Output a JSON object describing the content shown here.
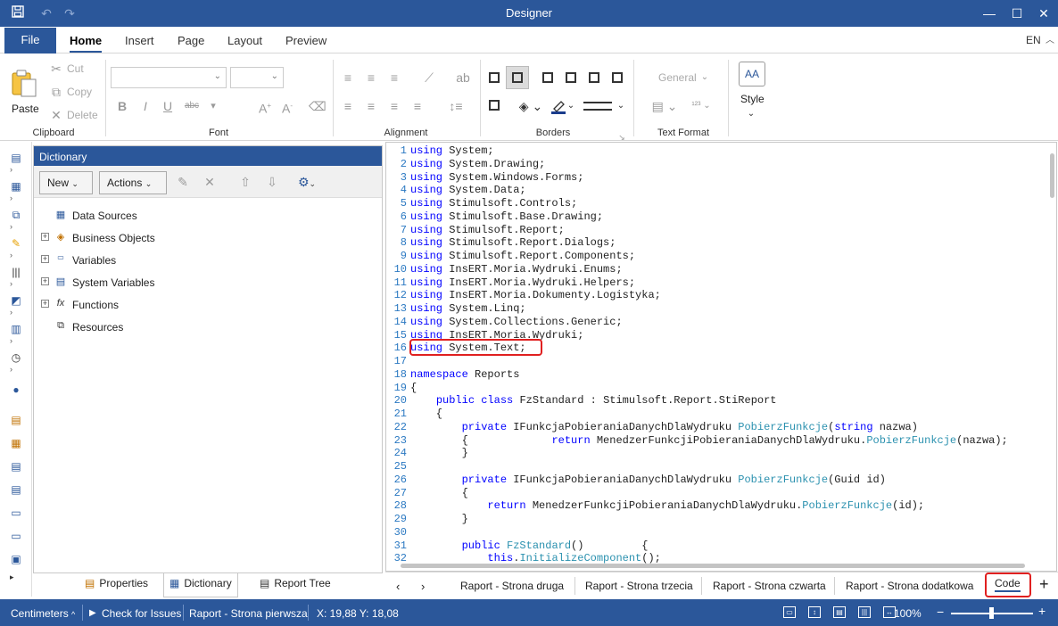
{
  "window": {
    "title": "Designer"
  },
  "ribbon_tabs": {
    "file": "File",
    "home": "Home",
    "insert": "Insert",
    "page": "Page",
    "layout": "Layout",
    "preview": "Preview",
    "language": "EN"
  },
  "clipboard": {
    "paste": "Paste",
    "cut": "Cut",
    "copy": "Copy",
    "delete": "Delete",
    "group": "Clipboard"
  },
  "groups": {
    "font": "Font",
    "alignment": "Alignment",
    "borders": "Borders",
    "text_format": "Text Format"
  },
  "text_format": {
    "format": "General",
    "style": "Style"
  },
  "dictionary": {
    "title": "Dictionary",
    "new_label": "New",
    "actions_label": "Actions",
    "items": [
      "Data Sources",
      "Business Objects",
      "Variables",
      "System Variables",
      "Functions",
      "Resources"
    ]
  },
  "panel_tabs": [
    "Properties",
    "Dictionary",
    "Report Tree"
  ],
  "code_lines": [
    [
      [
        "kw",
        "using"
      ],
      [
        "t",
        " System;"
      ]
    ],
    [
      [
        "kw",
        "using"
      ],
      [
        "t",
        " System.Drawing;"
      ]
    ],
    [
      [
        "kw",
        "using"
      ],
      [
        "t",
        " System.Windows.Forms;"
      ]
    ],
    [
      [
        "kw",
        "using"
      ],
      [
        "t",
        " System.Data;"
      ]
    ],
    [
      [
        "kw",
        "using"
      ],
      [
        "t",
        " Stimulsoft.Controls;"
      ]
    ],
    [
      [
        "kw",
        "using"
      ],
      [
        "t",
        " Stimulsoft.Base.Drawing;"
      ]
    ],
    [
      [
        "kw",
        "using"
      ],
      [
        "t",
        " Stimulsoft.Report;"
      ]
    ],
    [
      [
        "kw",
        "using"
      ],
      [
        "t",
        " Stimulsoft.Report.Dialogs;"
      ]
    ],
    [
      [
        "kw",
        "using"
      ],
      [
        "t",
        " Stimulsoft.Report.Components;"
      ]
    ],
    [
      [
        "kw",
        "using"
      ],
      [
        "t",
        " InsERT.Moria.Wydruki.Enums;"
      ]
    ],
    [
      [
        "kw",
        "using"
      ],
      [
        "t",
        " InsERT.Moria.Wydruki.Helpers;"
      ]
    ],
    [
      [
        "kw",
        "using"
      ],
      [
        "t",
        " InsERT.Moria.Dokumenty.Logistyka;"
      ]
    ],
    [
      [
        "kw",
        "using"
      ],
      [
        "t",
        " System.Linq;"
      ]
    ],
    [
      [
        "kw",
        "using"
      ],
      [
        "t",
        " System.Collections.Generic;"
      ]
    ],
    [
      [
        "kw",
        "using"
      ],
      [
        "t",
        " InsERT.Moria.Wydruki;"
      ]
    ],
    [
      [
        "kw",
        "using"
      ],
      [
        "t",
        " System.Text;"
      ]
    ],
    [],
    [
      [
        "kw",
        "namespace"
      ],
      [
        "t",
        " Reports"
      ]
    ],
    [
      [
        "t",
        "{"
      ]
    ],
    [
      [
        "t",
        "    "
      ],
      [
        "kw",
        "public"
      ],
      [
        "t",
        " "
      ],
      [
        "kw",
        "class"
      ],
      [
        "t",
        " FzStandard : Stimulsoft.Report.StiReport"
      ]
    ],
    [
      [
        "t",
        "    {"
      ]
    ],
    [
      [
        "t",
        "        "
      ],
      [
        "kw",
        "private"
      ],
      [
        "t",
        " IFunkcjaPobieraniaDanychDlaWydruku "
      ],
      [
        "mt",
        "PobierzFunkcje"
      ],
      [
        "t",
        "("
      ],
      [
        "kw",
        "string"
      ],
      [
        "t",
        " nazwa)"
      ]
    ],
    [
      [
        "t",
        "        {             "
      ],
      [
        "kw",
        "return"
      ],
      [
        "t",
        " MenedzerFunkcjiPobieraniaDanychDlaWydruku."
      ],
      [
        "mt",
        "PobierzFunkcje"
      ],
      [
        "t",
        "(nazwa);"
      ]
    ],
    [
      [
        "t",
        "        }"
      ]
    ],
    [],
    [
      [
        "t",
        "        "
      ],
      [
        "kw",
        "private"
      ],
      [
        "t",
        " IFunkcjaPobieraniaDanychDlaWydruku "
      ],
      [
        "mt",
        "PobierzFunkcje"
      ],
      [
        "t",
        "(Guid id)"
      ]
    ],
    [
      [
        "t",
        "        {"
      ]
    ],
    [
      [
        "t",
        "            "
      ],
      [
        "kw",
        "return"
      ],
      [
        "t",
        " MenedzerFunkcjiPobieraniaDanychDlaWydruku."
      ],
      [
        "mt",
        "PobierzFunkcje"
      ],
      [
        "t",
        "(id);"
      ]
    ],
    [
      [
        "t",
        "        }"
      ]
    ],
    [],
    [
      [
        "t",
        "        "
      ],
      [
        "kw",
        "public"
      ],
      [
        "t",
        " "
      ],
      [
        "mt",
        "FzStandard"
      ],
      [
        "t",
        "()         {"
      ]
    ],
    [
      [
        "t",
        "            "
      ],
      [
        "kw",
        "this"
      ],
      [
        "t",
        "."
      ],
      [
        "mt",
        "InitializeComponent"
      ],
      [
        "t",
        "();"
      ]
    ]
  ],
  "page_tabs": [
    "Raport - Strona druga",
    "Raport - Strona trzecia",
    "Raport - Strona czwarta",
    "Raport - Strona dodatkowa"
  ],
  "code_tab": "Code",
  "status": {
    "units": "Centimeters",
    "check": "Check for Issues",
    "page": "Raport - Strona pierwsza",
    "coords": "X: 19,88 Y: 18,08",
    "zoom": "100%"
  },
  "colors": {
    "accent": "#2b579a",
    "keyword": "#0000ff",
    "method": "#2b91af",
    "highlight": "#e02020"
  }
}
